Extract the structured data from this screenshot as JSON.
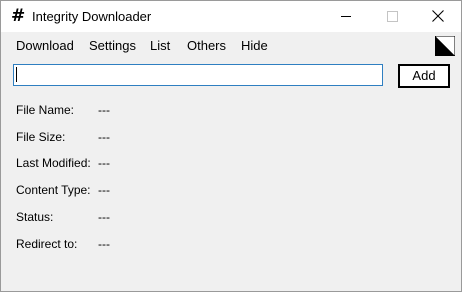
{
  "window": {
    "title": "Integrity Downloader",
    "icon_glyph": "#",
    "icon": "hash-icon",
    "controls": [
      "minimize-icon",
      "maximize-icon",
      "close-icon"
    ]
  },
  "menu": {
    "items": [
      "Download",
      "Settings",
      "List",
      "Others",
      "Hide"
    ],
    "corner_icon": "half-triangle-icon"
  },
  "url_input": {
    "value": "",
    "placeholder": ""
  },
  "add_button": {
    "label": "Add"
  },
  "info": [
    {
      "label": "File Name:",
      "value": "---"
    },
    {
      "label": "File Size:",
      "value": "---"
    },
    {
      "label": "Last Modified:",
      "value": "---"
    },
    {
      "label": "Content Type:",
      "value": "---"
    },
    {
      "label": "Status:",
      "value": "---"
    },
    {
      "label": "Redirect to:",
      "value": "---"
    }
  ],
  "colors": {
    "input_border": "#2f7fc1",
    "window_bg": "#f0f0f0",
    "titlebar_bg": "#ffffff"
  }
}
